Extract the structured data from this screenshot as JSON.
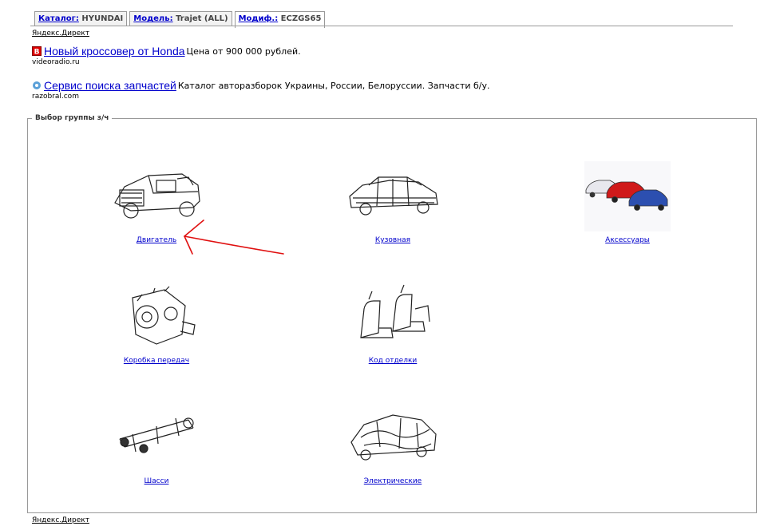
{
  "breadcrumb": [
    {
      "label": "Каталог:",
      "value": "HYUNDAI"
    },
    {
      "label": "Модель:",
      "value": "Trajet (ALL)"
    },
    {
      "label": "Модиф.:",
      "value": "ECZGS65"
    }
  ],
  "yandex_direct_label": "Яндекс.Директ",
  "ads": [
    {
      "icon": "b-badge-icon",
      "title": "Новый кроссовер от Honda",
      "text": "Цена от 900 000 рублей.",
      "host": "videoradio.ru"
    },
    {
      "icon": "gear-icon",
      "title": "Сервис поиска запчастей",
      "text": "Каталог авторазборок Украины, России, Белоруссии. Запчасти б/у.",
      "host": "razobral.com"
    }
  ],
  "group": {
    "legend": "Выбор группы з/ч",
    "items": [
      {
        "label": "Двигатель",
        "icon": "engine-icon"
      },
      {
        "label": "Кузовная",
        "icon": "body-frame-icon"
      },
      {
        "label": "Аксессуары",
        "icon": "cars-icon"
      },
      {
        "label": "Коробка передач",
        "icon": "gearbox-icon"
      },
      {
        "label": "Код отделки",
        "icon": "seats-icon"
      },
      {
        "label": "Шасси",
        "icon": "chassis-icon"
      },
      {
        "label": "Электрические",
        "icon": "wiring-icon"
      }
    ]
  },
  "colors": {
    "link": "#0000cc",
    "arrow": "#e01010"
  }
}
